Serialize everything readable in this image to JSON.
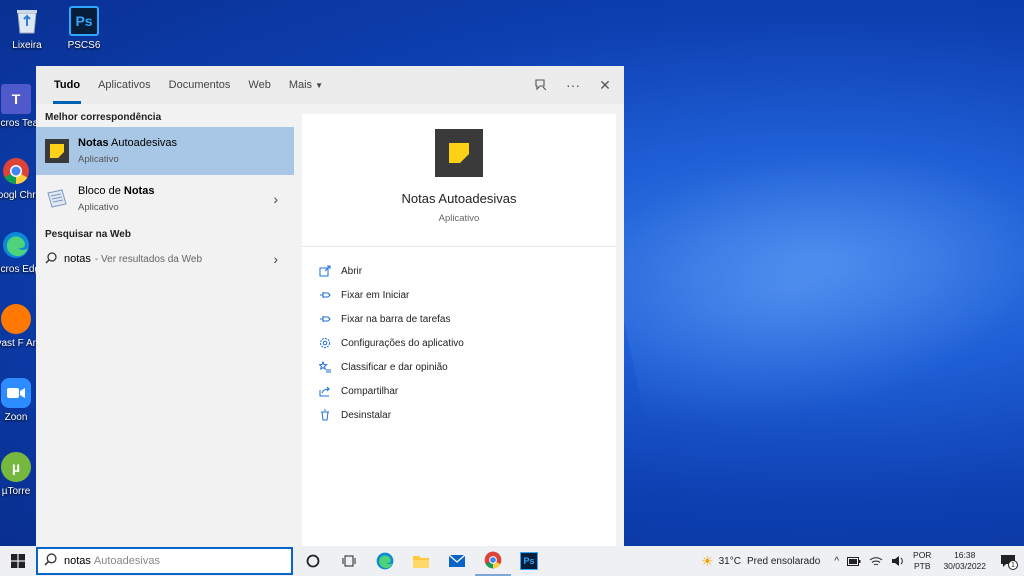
{
  "desktop": {
    "icons": [
      {
        "label": "Lixeira"
      },
      {
        "label": "PSCS6",
        "glyph": "Ps"
      },
      {
        "label": "Micros Team"
      },
      {
        "label": "Googl Chron"
      },
      {
        "label": "Micros Edge"
      },
      {
        "label": "Avast F Antivir"
      },
      {
        "label": "Zoon"
      },
      {
        "label": "µTorre"
      }
    ]
  },
  "search_panel": {
    "tabs": [
      "Tudo",
      "Aplicativos",
      "Documentos",
      "Web",
      "Mais"
    ],
    "active_tab": "Tudo",
    "tool_icons": [
      "feedback-icon",
      "more-icon",
      "close-icon"
    ],
    "more_glyph": "···",
    "close_glyph": "✕",
    "best_match_header": "Melhor correspondência",
    "results": [
      {
        "title_bold": "Notas",
        "title_rest": " Autoadesivas",
        "subtitle": "Aplicativo",
        "selected": true
      },
      {
        "title_pre": "Bloco de ",
        "title_bold": "Notas",
        "subtitle": "Aplicativo",
        "chevron": "›"
      }
    ],
    "web_header": "Pesquisar na Web",
    "web_result": {
      "query": "notas",
      "hint": "- Ver resultados da Web",
      "chevron": "›"
    },
    "detail": {
      "title": "Notas Autoadesivas",
      "subtitle": "Aplicativo",
      "actions": [
        {
          "label": "Abrir",
          "icon": "open-icon"
        },
        {
          "label": "Fixar em Iniciar",
          "icon": "pin-start-icon"
        },
        {
          "label": "Fixar na barra de tarefas",
          "icon": "pin-taskbar-icon"
        },
        {
          "label": "Configurações do aplicativo",
          "icon": "settings-icon"
        },
        {
          "label": "Classificar e dar opinião",
          "icon": "rate-icon"
        },
        {
          "label": "Compartilhar",
          "icon": "share-icon"
        },
        {
          "label": "Desinstalar",
          "icon": "trash-icon"
        }
      ]
    }
  },
  "taskbar": {
    "search_typed": "notas",
    "search_suggestion": "Autoadesivas",
    "apps": [
      "task-view-icon",
      "edge-icon",
      "file-explorer-icon",
      "mail-icon",
      "chrome-icon",
      "photoshop-icon"
    ],
    "ps_glyph": "Ps",
    "weather_temp": "31°C",
    "weather_desc": "Pred ensolarado",
    "lang_top": "POR",
    "lang_bottom": "PTB",
    "time": "16:38",
    "date": "30/03/2022",
    "notif_count": "1"
  },
  "colors": {
    "accent": "#0063b1",
    "selected_row": "#a8c7e6",
    "action_icon": "#1a6ed8"
  }
}
